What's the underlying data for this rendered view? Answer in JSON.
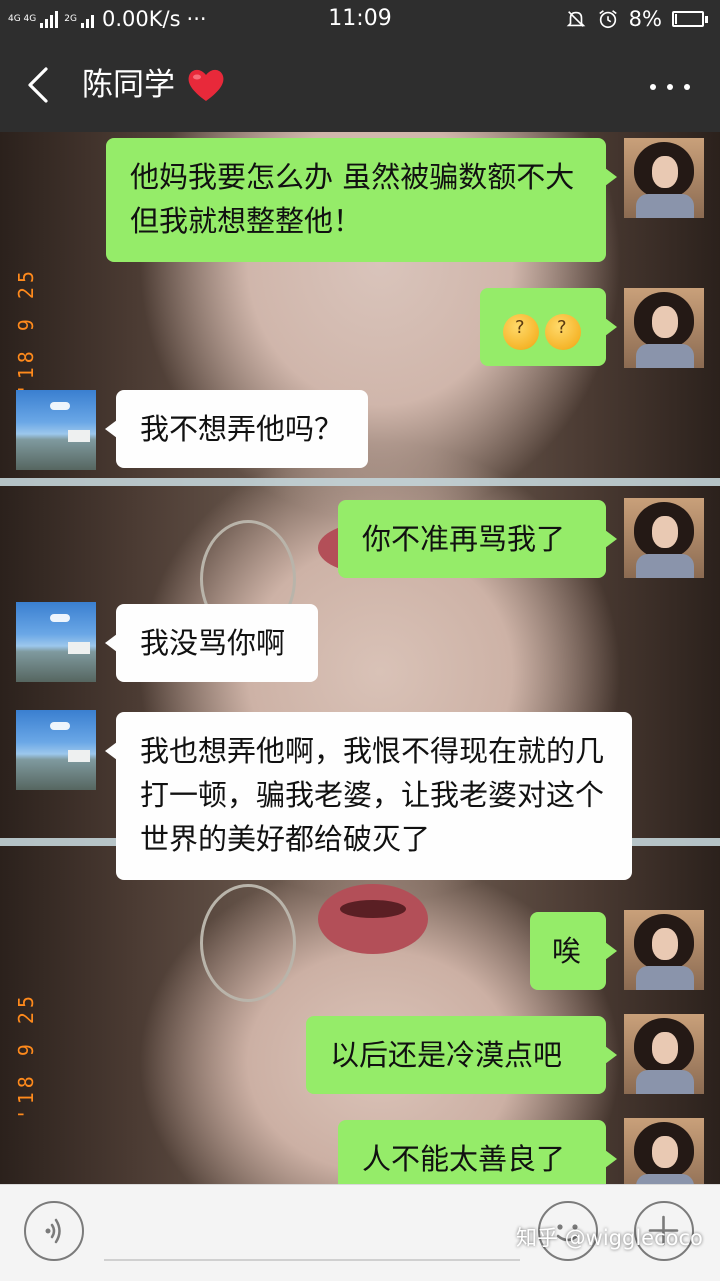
{
  "status_bar": {
    "net_top": "4G 4G",
    "net_2g": "2G",
    "speed": "0.00K/s",
    "dots": "···",
    "time": "11:09",
    "battery": "8%",
    "battery_level": 0.08,
    "icons": [
      "signal-bars-icon",
      "bell-muted-icon",
      "alarm-clock-icon",
      "battery-charging-icon"
    ]
  },
  "header": {
    "title": "陈同学",
    "title_emoji": "heart-icon",
    "heart_color": "#e8293a",
    "back_icon": "chevron-left-icon",
    "menu_icon": "more-dots-icon"
  },
  "background_stamp": {
    "top": "'18 9 25",
    "bottom": "'18 9 25"
  },
  "messages": [
    {
      "from": "me",
      "text": "他妈我要怎么办 虽然被骗数额不大 但我就想整整他！"
    },
    {
      "from": "me",
      "text": "",
      "emojis": [
        "confused-face-icon",
        "confused-face-icon"
      ]
    },
    {
      "from": "other",
      "text": "我不想弄他吗？"
    },
    {
      "from": "me",
      "text": "你不准再骂我了"
    },
    {
      "from": "other",
      "text": "我没骂你啊"
    },
    {
      "from": "other",
      "text": "我也想弄他啊，我恨不得现在就的几打一顿，骗我老婆，让我老婆对这个世界的美好都给破灭了"
    },
    {
      "from": "me",
      "text": "唉"
    },
    {
      "from": "me",
      "text": "以后还是冷漠点吧"
    },
    {
      "from": "me",
      "text": "人不能太善良了"
    }
  ],
  "input_bar": {
    "voice_icon": "voice-wave-icon",
    "emoji_icon": "smiley-face-icon",
    "plus_icon": "plus-icon",
    "placeholder": ""
  },
  "watermark": "知乎 @wigglecoco",
  "colors": {
    "bar_bg": "#2e2e2e",
    "my_bubble": "#95ec69",
    "other_bubble": "#fefefe",
    "stamp": "#ff8a1c"
  }
}
